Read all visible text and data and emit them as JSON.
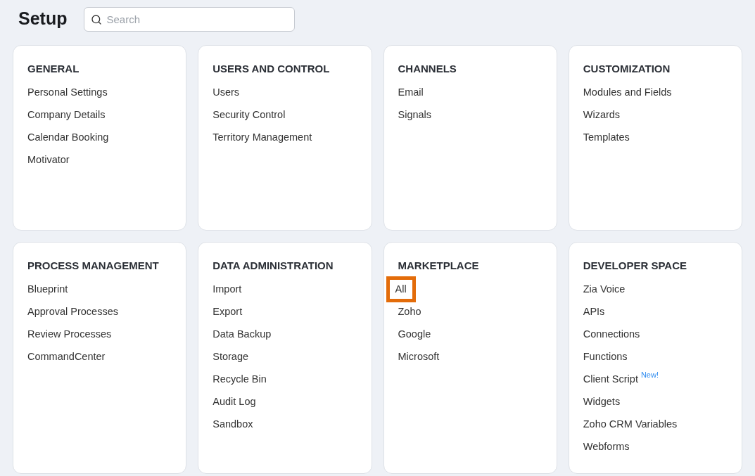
{
  "header": {
    "title": "Setup",
    "search": {
      "placeholder": "Search"
    }
  },
  "sections": [
    {
      "title": "GENERAL",
      "items": [
        {
          "label": "Personal Settings",
          "highlighted": false
        },
        {
          "label": "Company Details",
          "highlighted": false
        },
        {
          "label": "Calendar Booking",
          "highlighted": false
        },
        {
          "label": "Motivator",
          "highlighted": false
        }
      ]
    },
    {
      "title": "USERS AND CONTROL",
      "items": [
        {
          "label": "Users",
          "highlighted": false
        },
        {
          "label": "Security Control",
          "highlighted": false
        },
        {
          "label": "Territory Management",
          "highlighted": false
        }
      ]
    },
    {
      "title": "CHANNELS",
      "items": [
        {
          "label": "Email",
          "highlighted": false
        },
        {
          "label": "Signals",
          "highlighted": false
        }
      ]
    },
    {
      "title": "CUSTOMIZATION",
      "items": [
        {
          "label": "Modules and Fields",
          "highlighted": false
        },
        {
          "label": "Wizards",
          "highlighted": false
        },
        {
          "label": "Templates",
          "highlighted": false
        }
      ]
    },
    {
      "title": "PROCESS MANAGEMENT",
      "items": [
        {
          "label": "Blueprint",
          "highlighted": false
        },
        {
          "label": "Approval Processes",
          "highlighted": false
        },
        {
          "label": "Review Processes",
          "highlighted": false
        },
        {
          "label": "CommandCenter",
          "highlighted": false
        }
      ]
    },
    {
      "title": "DATA ADMINISTRATION",
      "items": [
        {
          "label": "Import",
          "highlighted": false
        },
        {
          "label": "Export",
          "highlighted": false
        },
        {
          "label": "Data Backup",
          "highlighted": false
        },
        {
          "label": "Storage",
          "highlighted": false
        },
        {
          "label": "Recycle Bin",
          "highlighted": false
        },
        {
          "label": "Audit Log",
          "highlighted": false
        },
        {
          "label": "Sandbox",
          "highlighted": false
        }
      ]
    },
    {
      "title": "MARKETPLACE",
      "items": [
        {
          "label": "All",
          "highlighted": true
        },
        {
          "label": "Zoho",
          "highlighted": false
        },
        {
          "label": "Google",
          "highlighted": false
        },
        {
          "label": "Microsoft",
          "highlighted": false
        }
      ]
    },
    {
      "title": "DEVELOPER SPACE",
      "items": [
        {
          "label": "Zia Voice",
          "highlighted": false
        },
        {
          "label": "APIs",
          "highlighted": false
        },
        {
          "label": "Connections",
          "highlighted": false
        },
        {
          "label": "Functions",
          "highlighted": false
        },
        {
          "label": "Client Script",
          "badge": "New!",
          "highlighted": false
        },
        {
          "label": "Widgets",
          "highlighted": false
        },
        {
          "label": "Zoho CRM Variables",
          "highlighted": false
        },
        {
          "label": "Webforms",
          "highlighted": false
        }
      ]
    }
  ]
}
